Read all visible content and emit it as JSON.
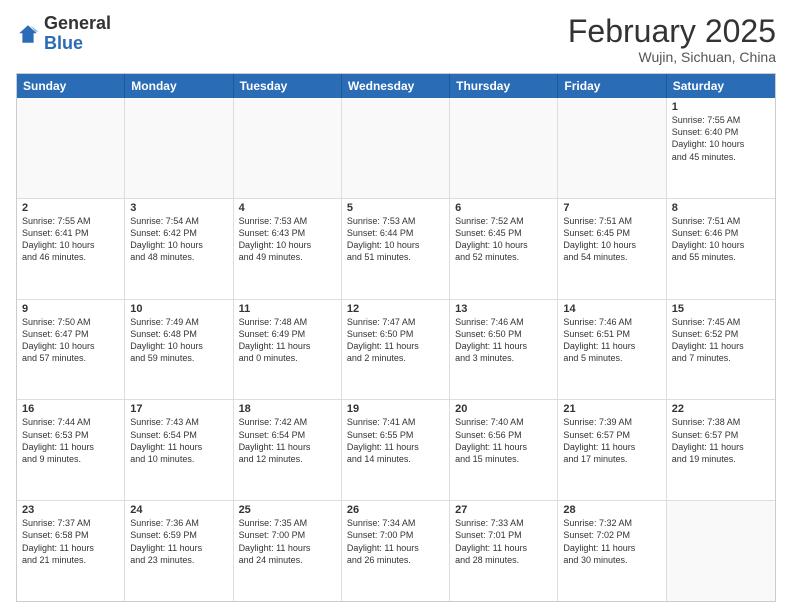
{
  "logo": {
    "general": "General",
    "blue": "Blue"
  },
  "header": {
    "month": "February 2025",
    "location": "Wujin, Sichuan, China"
  },
  "days": [
    "Sunday",
    "Monday",
    "Tuesday",
    "Wednesday",
    "Thursday",
    "Friday",
    "Saturday"
  ],
  "rows": [
    [
      {
        "day": "",
        "empty": true
      },
      {
        "day": "",
        "empty": true
      },
      {
        "day": "",
        "empty": true
      },
      {
        "day": "",
        "empty": true
      },
      {
        "day": "",
        "empty": true
      },
      {
        "day": "",
        "empty": true
      },
      {
        "day": "1",
        "lines": [
          "Sunrise: 7:55 AM",
          "Sunset: 6:40 PM",
          "Daylight: 10 hours",
          "and 45 minutes."
        ]
      }
    ],
    [
      {
        "day": "2",
        "lines": [
          "Sunrise: 7:55 AM",
          "Sunset: 6:41 PM",
          "Daylight: 10 hours",
          "and 46 minutes."
        ]
      },
      {
        "day": "3",
        "lines": [
          "Sunrise: 7:54 AM",
          "Sunset: 6:42 PM",
          "Daylight: 10 hours",
          "and 48 minutes."
        ]
      },
      {
        "day": "4",
        "lines": [
          "Sunrise: 7:53 AM",
          "Sunset: 6:43 PM",
          "Daylight: 10 hours",
          "and 49 minutes."
        ]
      },
      {
        "day": "5",
        "lines": [
          "Sunrise: 7:53 AM",
          "Sunset: 6:44 PM",
          "Daylight: 10 hours",
          "and 51 minutes."
        ]
      },
      {
        "day": "6",
        "lines": [
          "Sunrise: 7:52 AM",
          "Sunset: 6:45 PM",
          "Daylight: 10 hours",
          "and 52 minutes."
        ]
      },
      {
        "day": "7",
        "lines": [
          "Sunrise: 7:51 AM",
          "Sunset: 6:45 PM",
          "Daylight: 10 hours",
          "and 54 minutes."
        ]
      },
      {
        "day": "8",
        "lines": [
          "Sunrise: 7:51 AM",
          "Sunset: 6:46 PM",
          "Daylight: 10 hours",
          "and 55 minutes."
        ]
      }
    ],
    [
      {
        "day": "9",
        "lines": [
          "Sunrise: 7:50 AM",
          "Sunset: 6:47 PM",
          "Daylight: 10 hours",
          "and 57 minutes."
        ]
      },
      {
        "day": "10",
        "lines": [
          "Sunrise: 7:49 AM",
          "Sunset: 6:48 PM",
          "Daylight: 10 hours",
          "and 59 minutes."
        ]
      },
      {
        "day": "11",
        "lines": [
          "Sunrise: 7:48 AM",
          "Sunset: 6:49 PM",
          "Daylight: 11 hours",
          "and 0 minutes."
        ]
      },
      {
        "day": "12",
        "lines": [
          "Sunrise: 7:47 AM",
          "Sunset: 6:50 PM",
          "Daylight: 11 hours",
          "and 2 minutes."
        ]
      },
      {
        "day": "13",
        "lines": [
          "Sunrise: 7:46 AM",
          "Sunset: 6:50 PM",
          "Daylight: 11 hours",
          "and 3 minutes."
        ]
      },
      {
        "day": "14",
        "lines": [
          "Sunrise: 7:46 AM",
          "Sunset: 6:51 PM",
          "Daylight: 11 hours",
          "and 5 minutes."
        ]
      },
      {
        "day": "15",
        "lines": [
          "Sunrise: 7:45 AM",
          "Sunset: 6:52 PM",
          "Daylight: 11 hours",
          "and 7 minutes."
        ]
      }
    ],
    [
      {
        "day": "16",
        "lines": [
          "Sunrise: 7:44 AM",
          "Sunset: 6:53 PM",
          "Daylight: 11 hours",
          "and 9 minutes."
        ]
      },
      {
        "day": "17",
        "lines": [
          "Sunrise: 7:43 AM",
          "Sunset: 6:54 PM",
          "Daylight: 11 hours",
          "and 10 minutes."
        ]
      },
      {
        "day": "18",
        "lines": [
          "Sunrise: 7:42 AM",
          "Sunset: 6:54 PM",
          "Daylight: 11 hours",
          "and 12 minutes."
        ]
      },
      {
        "day": "19",
        "lines": [
          "Sunrise: 7:41 AM",
          "Sunset: 6:55 PM",
          "Daylight: 11 hours",
          "and 14 minutes."
        ]
      },
      {
        "day": "20",
        "lines": [
          "Sunrise: 7:40 AM",
          "Sunset: 6:56 PM",
          "Daylight: 11 hours",
          "and 15 minutes."
        ]
      },
      {
        "day": "21",
        "lines": [
          "Sunrise: 7:39 AM",
          "Sunset: 6:57 PM",
          "Daylight: 11 hours",
          "and 17 minutes."
        ]
      },
      {
        "day": "22",
        "lines": [
          "Sunrise: 7:38 AM",
          "Sunset: 6:57 PM",
          "Daylight: 11 hours",
          "and 19 minutes."
        ]
      }
    ],
    [
      {
        "day": "23",
        "lines": [
          "Sunrise: 7:37 AM",
          "Sunset: 6:58 PM",
          "Daylight: 11 hours",
          "and 21 minutes."
        ]
      },
      {
        "day": "24",
        "lines": [
          "Sunrise: 7:36 AM",
          "Sunset: 6:59 PM",
          "Daylight: 11 hours",
          "and 23 minutes."
        ]
      },
      {
        "day": "25",
        "lines": [
          "Sunrise: 7:35 AM",
          "Sunset: 7:00 PM",
          "Daylight: 11 hours",
          "and 24 minutes."
        ]
      },
      {
        "day": "26",
        "lines": [
          "Sunrise: 7:34 AM",
          "Sunset: 7:00 PM",
          "Daylight: 11 hours",
          "and 26 minutes."
        ]
      },
      {
        "day": "27",
        "lines": [
          "Sunrise: 7:33 AM",
          "Sunset: 7:01 PM",
          "Daylight: 11 hours",
          "and 28 minutes."
        ]
      },
      {
        "day": "28",
        "lines": [
          "Sunrise: 7:32 AM",
          "Sunset: 7:02 PM",
          "Daylight: 11 hours",
          "and 30 minutes."
        ]
      },
      {
        "day": "",
        "empty": true
      }
    ]
  ]
}
